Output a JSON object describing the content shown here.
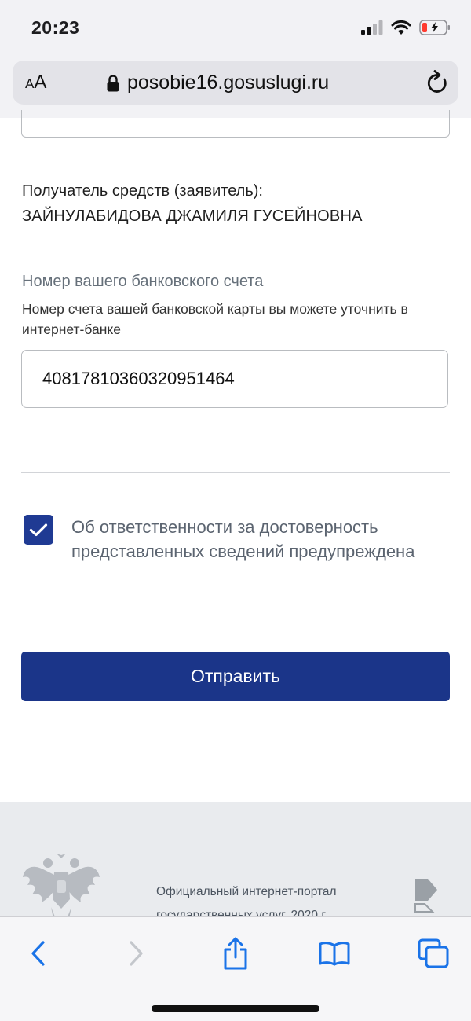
{
  "status_bar": {
    "time": "20:23"
  },
  "address_bar": {
    "text_size_label_small": "A",
    "text_size_label_large": "A",
    "url": "posobie16.gosuslugi.ru"
  },
  "form": {
    "recipient_label": "Получатель средств (заявитель):",
    "recipient_name": "ЗАЙНУЛАБИДОВА ДЖАМИЛЯ ГУСЕЙНОВНА",
    "account_label": "Номер вашего банковского счета",
    "account_hint": "Номер счета вашей банковской карты вы можете уточнить в интернет-банке",
    "account_value": "40817810360320951464",
    "consent_checked": true,
    "consent_label": "Об ответственности за достоверность представленных сведений предупреждена",
    "submit_label": "Отправить"
  },
  "footer": {
    "line1": "Официальный интернет-портал",
    "line2": "государственных услуг, 2020 г."
  },
  "colors": {
    "accent": "#1b3589",
    "checkbox": "#1f3a93",
    "ios_blue": "#1a73e8"
  }
}
